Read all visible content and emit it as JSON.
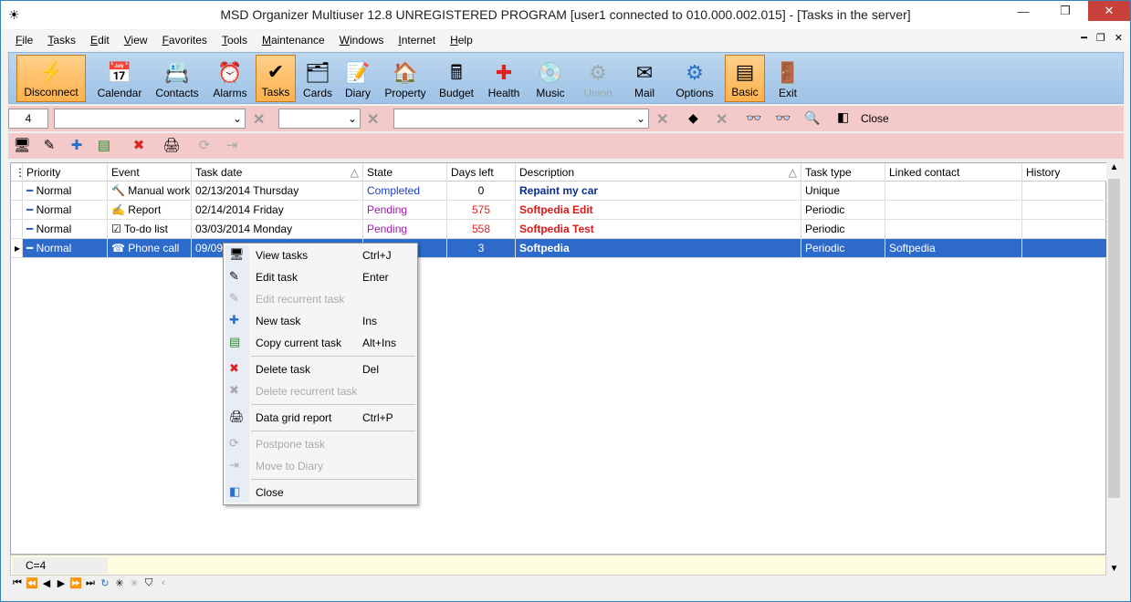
{
  "window": {
    "title": "MSD Organizer Multiuser 12.8 UNREGISTERED PROGRAM [user1 connected to 010.000.002.015] - [Tasks in the server]"
  },
  "menu": [
    "File",
    "Tasks",
    "Edit",
    "View",
    "Favorites",
    "Tools",
    "Maintenance",
    "Windows",
    "Internet",
    "Help"
  ],
  "toolbar": [
    "Disconnect",
    "Calendar",
    "Contacts",
    "Alarms",
    "Tasks",
    "Cards",
    "Diary",
    "Property",
    "Budget",
    "Health",
    "Music",
    "Union",
    "Mail",
    "Options",
    "Basic",
    "Exit"
  ],
  "filter": {
    "count": "4",
    "close_label": "Close"
  },
  "columns": [
    "Priority",
    "Event",
    "Task date",
    "State",
    "Days left",
    "Description",
    "Task type",
    "Linked contact",
    "History"
  ],
  "rows": [
    {
      "priority": "Normal",
      "event": "Manual work",
      "date": "02/13/2014 Thursday",
      "state": "Completed",
      "days": "0",
      "desc": "Repaint my car",
      "type": "Unique",
      "contact": ""
    },
    {
      "priority": "Normal",
      "event": "Report",
      "date": "02/14/2014 Friday",
      "state": "Pending",
      "days": "575",
      "desc": "Softpedia Edit",
      "type": "Periodic",
      "contact": ""
    },
    {
      "priority": "Normal",
      "event": "To-do list",
      "date": "03/03/2014 Monday",
      "state": "Pending",
      "days": "558",
      "desc": "Softpedia Test",
      "type": "Periodic",
      "contact": ""
    },
    {
      "priority": "Normal",
      "event": "Phone call",
      "date": "09/09/",
      "state": "",
      "days": "3",
      "desc": "Softpedia",
      "type": "Periodic",
      "contact": "Softpedia"
    }
  ],
  "context_menu": [
    {
      "label": "View tasks",
      "shortcut": "Ctrl+J"
    },
    {
      "label": "Edit task",
      "shortcut": "Enter"
    },
    {
      "label": "Edit recurrent task",
      "shortcut": ""
    },
    {
      "label": "New task",
      "shortcut": "Ins"
    },
    {
      "label": "Copy current task",
      "shortcut": "Alt+Ins"
    },
    {
      "label": "Delete task",
      "shortcut": "Del"
    },
    {
      "label": "Delete recurrent task",
      "shortcut": ""
    },
    {
      "label": "Data grid report",
      "shortcut": "Ctrl+P"
    },
    {
      "label": "Postpone task",
      "shortcut": ""
    },
    {
      "label": "Move to Diary",
      "shortcut": ""
    },
    {
      "label": "Close",
      "shortcut": ""
    }
  ],
  "status": {
    "count": "C=4"
  }
}
